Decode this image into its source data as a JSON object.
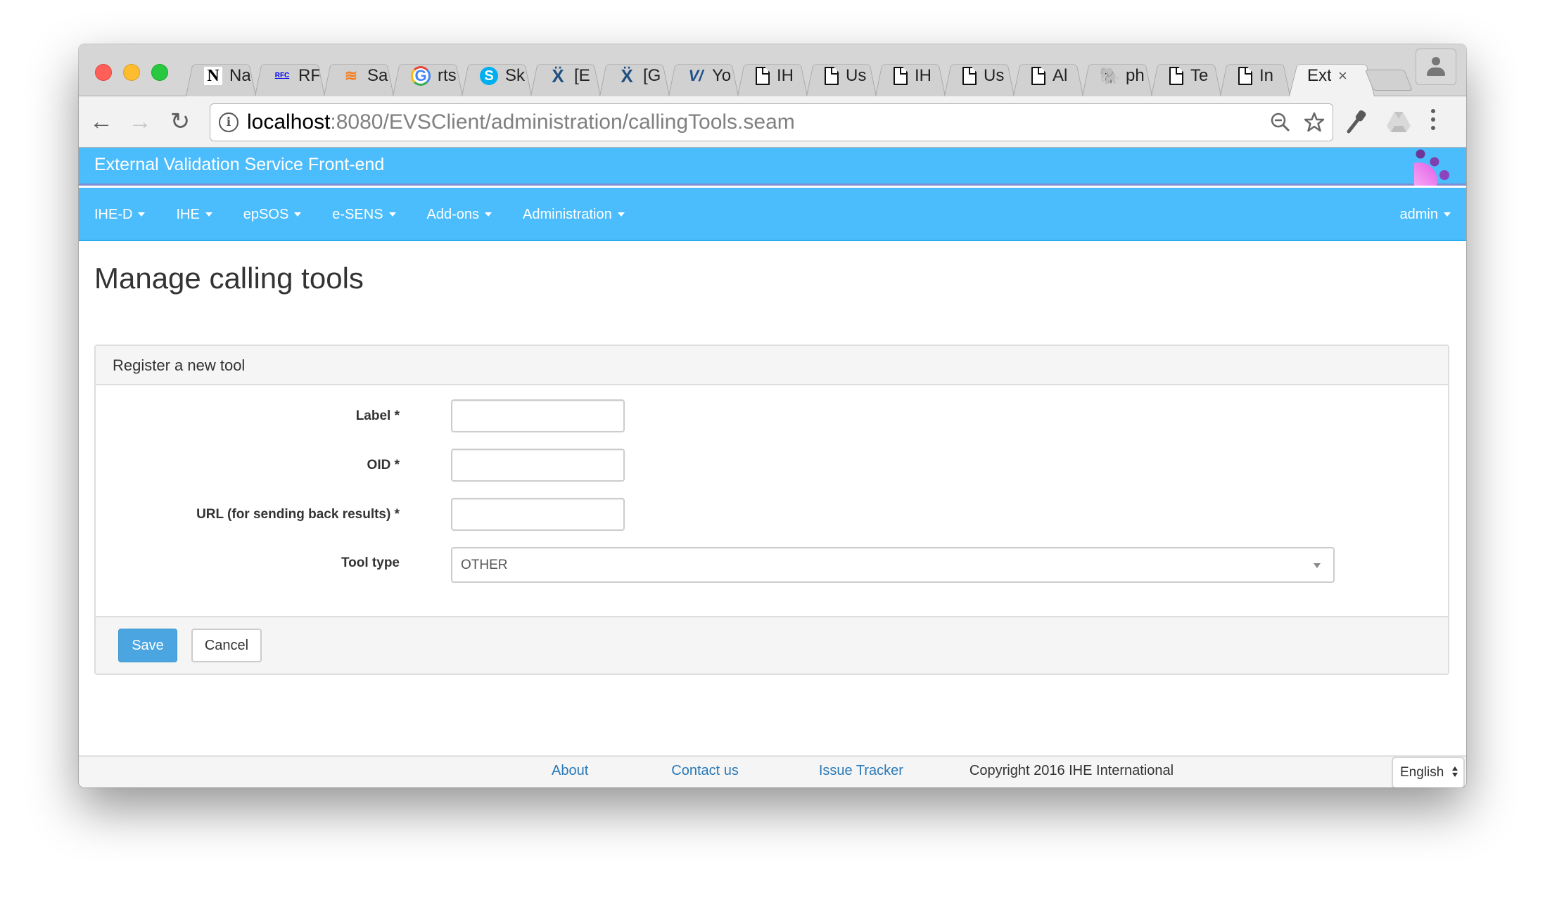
{
  "browser": {
    "tabs": [
      {
        "icon": "notion-n-icon",
        "glyph": "N",
        "title": "Na"
      },
      {
        "icon": "rfc-html-icon",
        "glyph": "RFC",
        "title": "RF"
      },
      {
        "icon": "stackoverflow-icon",
        "glyph": "≋",
        "title": "Sa"
      },
      {
        "icon": "google-icon",
        "glyph": "G",
        "title": "rts"
      },
      {
        "icon": "skype-icon",
        "glyph": "S",
        "title": "Sk"
      },
      {
        "icon": "jira-icon",
        "glyph": "Ẍ",
        "title": "[E"
      },
      {
        "icon": "jira-icon",
        "glyph": "Ẍ",
        "title": "[G"
      },
      {
        "icon": "vmware-icon",
        "glyph": "V/",
        "title": "Yo"
      },
      {
        "icon": "document-icon",
        "glyph": "",
        "title": "IH"
      },
      {
        "icon": "document-icon",
        "glyph": "",
        "title": "Us"
      },
      {
        "icon": "document-icon",
        "glyph": "",
        "title": "IH"
      },
      {
        "icon": "document-icon",
        "glyph": "",
        "title": "Us"
      },
      {
        "icon": "document-icon",
        "glyph": "",
        "title": "Al"
      },
      {
        "icon": "postgresql-elephant-icon",
        "glyph": "🐘",
        "title": "ph"
      },
      {
        "icon": "document-icon",
        "glyph": "",
        "title": "Te"
      },
      {
        "icon": "document-icon",
        "glyph": "",
        "title": "In"
      },
      {
        "icon": "",
        "glyph": "",
        "title": "Ext",
        "active": true,
        "close": "×"
      }
    ],
    "url_host": "localhost",
    "url_rest": ":8080/EVSClient/administration/callingTools.seam",
    "icons": {
      "back": "←",
      "forward": "→",
      "reload": "↻",
      "info": "i",
      "zoom": "⊖",
      "star": "☆",
      "key": "🔑"
    }
  },
  "app": {
    "title": "External Validation Service Front-end",
    "nav": [
      {
        "label": "IHE-D"
      },
      {
        "label": "IHE"
      },
      {
        "label": "epSOS"
      },
      {
        "label": "e-SENS"
      },
      {
        "label": "Add-ons"
      },
      {
        "label": "Administration"
      }
    ],
    "user": "admin",
    "colors": {
      "header": "#4bbcfc",
      "save_button": "#4aa5e0",
      "link": "#2a7ab8"
    }
  },
  "main": {
    "page_title": "Manage calling tools",
    "panel_title": "Register a new tool",
    "fields": [
      {
        "label": "Label *",
        "value": "",
        "placeholder": ""
      },
      {
        "label": "OID *",
        "value": "",
        "placeholder": ""
      },
      {
        "label": "URL (for sending back results) *",
        "value": "",
        "placeholder": ""
      }
    ],
    "tool_type": {
      "label": "Tool type",
      "selected": "OTHER"
    },
    "save_label": "Save",
    "cancel_label": "Cancel"
  },
  "footer": {
    "links": [
      "About",
      "Contact us",
      "Issue Tracker"
    ],
    "copyright": "Copyright 2016 IHE International",
    "language": "English"
  }
}
